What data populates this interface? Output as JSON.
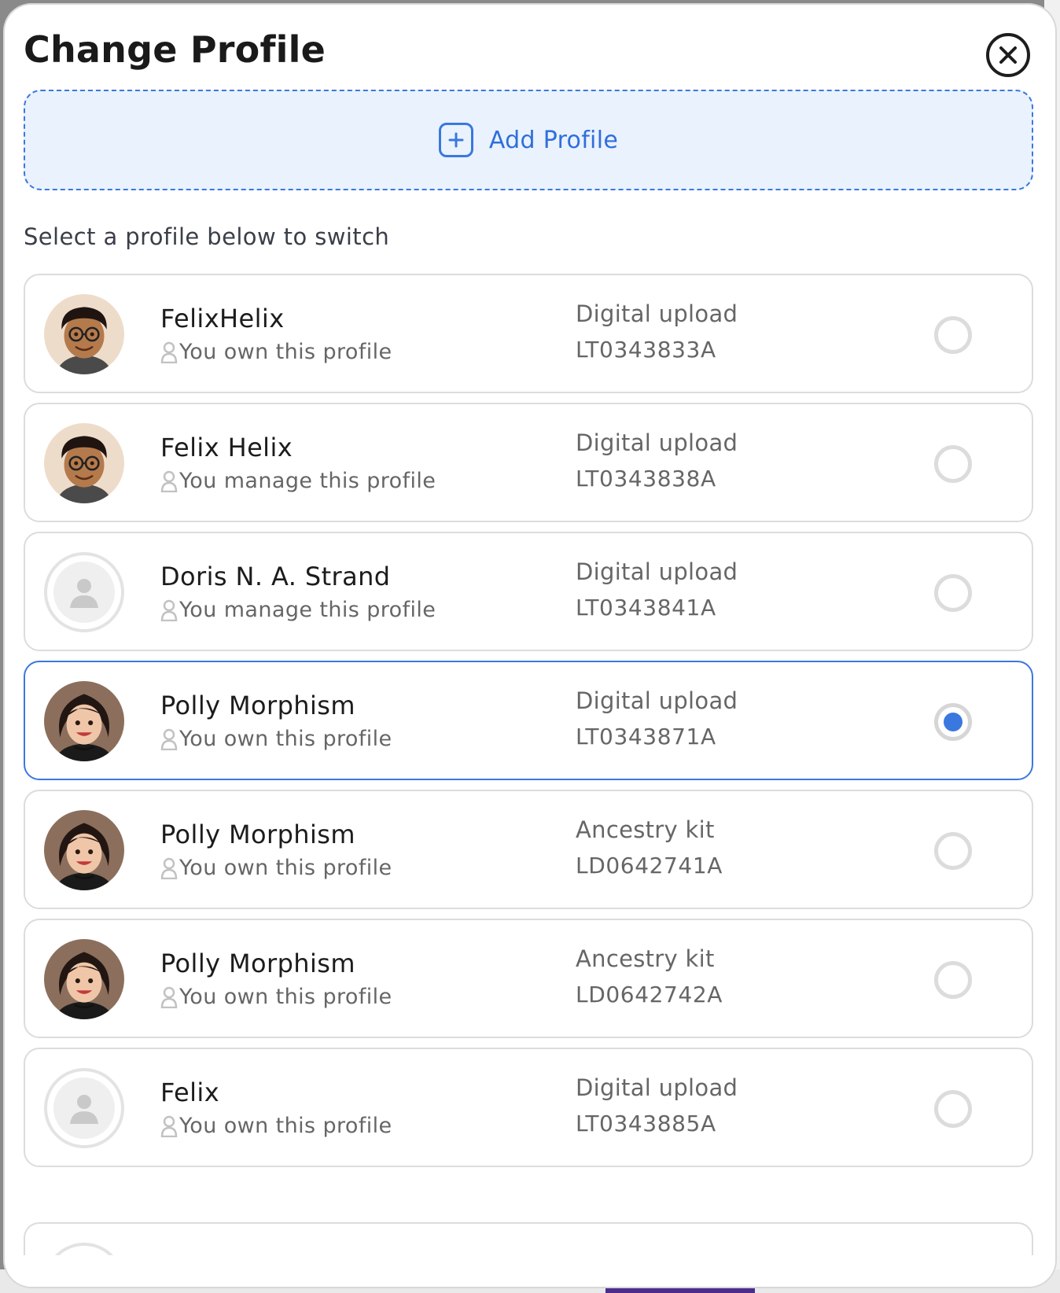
{
  "modal": {
    "title": "Change Profile",
    "close_icon": "close-circle-icon",
    "add_profile_label": "Add Profile",
    "add_profile_icon": "plus-square-icon",
    "hint": "Select a profile below to switch",
    "accent_color": "#3a78e0"
  },
  "profiles": [
    {
      "name": "FelixHelix",
      "role": "You own this profile",
      "kit_type": "Digital upload",
      "code": "LT0343833A",
      "avatar": "felix-cartoon",
      "selected": false
    },
    {
      "name": "Felix Helix",
      "role": "You manage this profile",
      "kit_type": "Digital upload",
      "code": "LT0343838A",
      "avatar": "felix-cartoon",
      "selected": false
    },
    {
      "name": "Doris N. A. Strand",
      "role": "You manage this profile",
      "kit_type": "Digital upload",
      "code": "LT0343841A",
      "avatar": "placeholder",
      "selected": false
    },
    {
      "name": "Polly Morphism",
      "role": "You own this profile",
      "kit_type": "Digital upload",
      "code": "LT0343871A",
      "avatar": "polly-cartoon",
      "selected": true
    },
    {
      "name": "Polly Morphism",
      "role": "You own this profile",
      "kit_type": "Ancestry kit",
      "code": "LD0642741A",
      "avatar": "polly-cartoon",
      "selected": false
    },
    {
      "name": "Polly Morphism",
      "role": "You own this profile",
      "kit_type": "Ancestry kit",
      "code": "LD0642742A",
      "avatar": "polly-cartoon",
      "selected": false
    },
    {
      "name": "Felix",
      "role": "You own this profile",
      "kit_type": "Digital upload",
      "code": "LT0343885A",
      "avatar": "placeholder",
      "selected": false
    }
  ]
}
